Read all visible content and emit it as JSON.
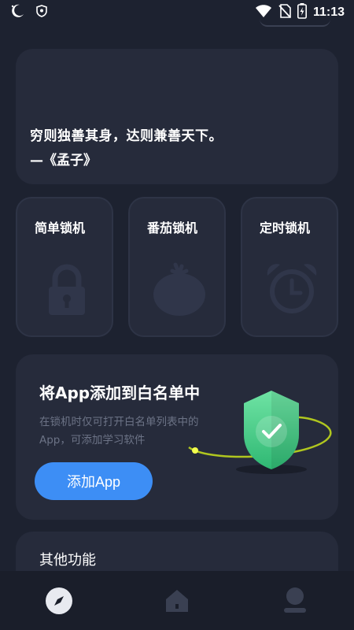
{
  "status_bar": {
    "time": "11:13",
    "icons": [
      "moon-icon",
      "shield-icon",
      "wifi-icon",
      "no-sim-icon",
      "battery-icon"
    ]
  },
  "quote": {
    "text": "穷则独善其身，达则兼善天下。",
    "author": "—《孟子》"
  },
  "modes": [
    {
      "label": "简单锁机",
      "icon": "lock-icon"
    },
    {
      "label": "番茄锁机",
      "icon": "tomato-icon"
    },
    {
      "label": "定时锁机",
      "icon": "alarm-clock-icon"
    }
  ],
  "whitelist": {
    "title": "将App添加到白名单中",
    "description": "在锁机时仅可打开白名单列表中的App，可添加学习软件",
    "button_label": "添加App"
  },
  "other": {
    "title": "其他功能"
  },
  "bottom_nav": {
    "items": [
      "compass-icon",
      "home-icon",
      "profile-icon"
    ]
  },
  "colors": {
    "background": "#1d2230",
    "card": "#262b3b",
    "accent": "#3d8ef5",
    "shield_green": "#4fd28a"
  }
}
